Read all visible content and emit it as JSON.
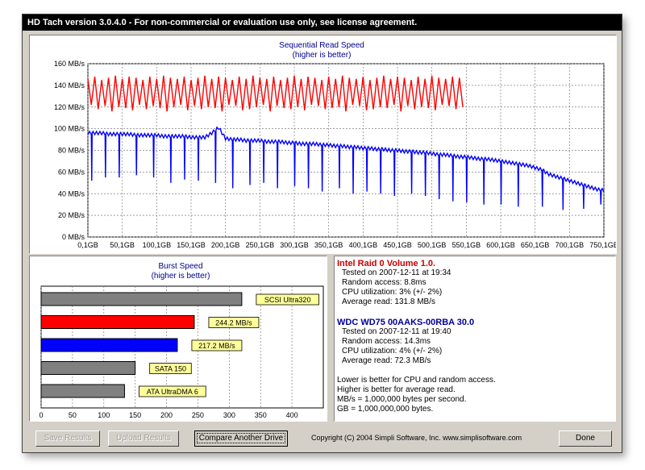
{
  "window": {
    "title": "HD Tach version 3.0.4.0  - For non-commercial or evaluation use only, see license agreement."
  },
  "colors": {
    "drive1": "#ff0000",
    "drive2": "#0000ff",
    "grey_bar": "#808080",
    "label_bg": "#ffff99",
    "title_text": "#00008b"
  },
  "chart_data": [
    {
      "type": "line",
      "title": "Sequential Read Speed",
      "subtitle": "(higher is better)",
      "ylim": [
        0,
        160
      ],
      "yticks": [
        "0 MB/s",
        "20 MB/s",
        "40 MB/s",
        "60 MB/s",
        "80 MB/s",
        "100 MB/s",
        "120 MB/s",
        "140 MB/s",
        "160 MB/s"
      ],
      "xlim": [
        0.1,
        750.1
      ],
      "xticks": [
        "0,1GB",
        "50,1GB",
        "100,1GB",
        "150,1GB",
        "200,1GB",
        "250,1GB",
        "300,1GB",
        "350,1GB",
        "400,1GB",
        "450,1GB",
        "500,1GB",
        "550,1GB",
        "600,1GB",
        "650,1GB",
        "700,1GB",
        "750,1GB"
      ],
      "grid": true,
      "series": [
        {
          "name": "Intel Raid 0 Volume 1.0.",
          "color": "#ff0000",
          "x": [
            0,
            10,
            20,
            30,
            40,
            50,
            60,
            70,
            80,
            90,
            100,
            110,
            120,
            130,
            140,
            150,
            160,
            170,
            180,
            190,
            200,
            210,
            220,
            230,
            240,
            250,
            260,
            270,
            280,
            290,
            300,
            310,
            320,
            330,
            340,
            350,
            360,
            370,
            380,
            390,
            400,
            410,
            420,
            430,
            440,
            450,
            460,
            470,
            480,
            490,
            500,
            510,
            520,
            530,
            540
          ],
          "high": [
            146,
            148,
            145,
            147,
            149,
            146,
            148,
            147,
            145,
            148,
            146,
            149,
            147,
            146,
            148,
            145,
            147,
            149,
            146,
            148,
            147,
            145,
            148,
            146,
            149,
            147,
            146,
            148,
            145,
            147,
            149,
            146,
            148,
            147,
            145,
            148,
            146,
            149,
            147,
            146,
            148,
            145,
            147,
            149,
            146,
            148,
            147,
            145,
            148,
            146,
            149,
            147,
            146,
            148,
            147
          ],
          "low": [
            122,
            118,
            121,
            116,
            120,
            119,
            117,
            122,
            118,
            121,
            119,
            116,
            120,
            122,
            117,
            121,
            118,
            120,
            119,
            116,
            122,
            121,
            117,
            118,
            120,
            122,
            116,
            121,
            119,
            118,
            120,
            117,
            122,
            121,
            118,
            119,
            120,
            116,
            122,
            121,
            117,
            118,
            120,
            119,
            122,
            116,
            121,
            118,
            120,
            119,
            117,
            122,
            121,
            118,
            120
          ]
        },
        {
          "name": "WDC WD75 00AAKS-00RBA 30.0",
          "color": "#0000ff",
          "x": [
            0,
            10,
            20,
            30,
            40,
            50,
            60,
            70,
            80,
            90,
            100,
            110,
            120,
            130,
            140,
            150,
            160,
            170,
            180,
            190,
            200,
            210,
            220,
            230,
            240,
            250,
            260,
            270,
            280,
            290,
            300,
            310,
            320,
            330,
            340,
            350,
            360,
            370,
            380,
            390,
            400,
            410,
            420,
            430,
            440,
            450,
            460,
            470,
            480,
            490,
            500,
            510,
            520,
            530,
            540,
            550,
            560,
            570,
            580,
            590,
            600,
            610,
            620,
            630,
            640,
            650,
            660,
            670,
            680,
            690,
            700,
            710,
            720,
            730,
            740,
            750
          ],
          "values": [
            96,
            96,
            96,
            95,
            95,
            95,
            95,
            94,
            94,
            94,
            94,
            93,
            93,
            93,
            93,
            92,
            92,
            92,
            96,
            101,
            91,
            90,
            90,
            89,
            89,
            89,
            88,
            88,
            88,
            87,
            87,
            86,
            86,
            86,
            85,
            85,
            84,
            84,
            83,
            83,
            82,
            82,
            81,
            81,
            80,
            80,
            79,
            79,
            78,
            78,
            77,
            76,
            76,
            75,
            74,
            74,
            73,
            72,
            72,
            71,
            70,
            69,
            68,
            67,
            66,
            64,
            62,
            58,
            56,
            54,
            52,
            50,
            48,
            46,
            44,
            43
          ],
          "dips": [
            [
              5,
              52
            ],
            [
              25,
              55
            ],
            [
              45,
              55
            ],
            [
              70,
              57
            ],
            [
              95,
              55
            ],
            [
              120,
              50
            ],
            [
              140,
              53
            ],
            [
              160,
              52
            ],
            [
              185,
              50
            ],
            [
              210,
              45
            ],
            [
              235,
              48
            ],
            [
              255,
              50
            ],
            [
              275,
              45
            ],
            [
              300,
              47
            ],
            [
              320,
              45
            ],
            [
              340,
              42
            ],
            [
              365,
              45
            ],
            [
              385,
              40
            ],
            [
              405,
              42
            ],
            [
              425,
              40
            ],
            [
              445,
              38
            ],
            [
              470,
              40
            ],
            [
              490,
              38
            ],
            [
              510,
              35
            ],
            [
              530,
              33
            ],
            [
              550,
              32
            ],
            [
              575,
              30
            ],
            [
              600,
              30
            ],
            [
              625,
              28
            ],
            [
              660,
              28
            ],
            [
              690,
              25
            ],
            [
              720,
              26
            ],
            [
              745,
              30
            ]
          ]
        }
      ]
    },
    {
      "type": "bar",
      "orientation": "horizontal",
      "title": "Burst Speed",
      "subtitle": "(higher is better)",
      "xlim": [
        0,
        450
      ],
      "xticks": [
        "0",
        "50",
        "100",
        "150",
        "200",
        "250",
        "300",
        "350",
        "400"
      ],
      "grid": true,
      "bars": [
        {
          "value": 320,
          "color": "#808080",
          "label": "SCSI Ultra320"
        },
        {
          "value": 244.2,
          "color": "#ff0000",
          "label": "244.2 MB/s"
        },
        {
          "value": 217.2,
          "color": "#0000ff",
          "label": "217.2 MB/s"
        },
        {
          "value": 150,
          "color": "#808080",
          "label": "SATA 150"
        },
        {
          "value": 133,
          "color": "#808080",
          "label": "ATA UltraDMA 6"
        }
      ]
    }
  ],
  "info": {
    "drive1": {
      "name": "Intel Raid 0 Volume 1.0.",
      "color": "#cc0000",
      "tested": "Tested on 2007-12-11 at 19:34",
      "random_access": "Random access: 8.8ms",
      "cpu": "CPU utilization: 3% (+/- 2%)",
      "avg_read": "Average read: 131.8 MB/s"
    },
    "drive2": {
      "name": "WDC WD75 00AAKS-00RBA 30.0",
      "color": "#000099",
      "tested": "Tested on 2007-12-11 at 19:40",
      "random_access": "Random access: 14.3ms",
      "cpu": "CPU utilization: 4% (+/- 2%)",
      "avg_read": "Average read: 72.3 MB/s"
    },
    "notes": [
      "Lower is better for CPU and random access.",
      "Higher is better for average read.",
      "MB/s = 1,000,000 bytes per second.",
      "GB = 1,000,000,000 bytes."
    ]
  },
  "buttons": {
    "save": "Save Results",
    "upload": "Upload Results",
    "compare": "Compare Another Drive",
    "done": "Done"
  },
  "copyright": "Copyright (C) 2004 Simpli Software, Inc. www.simplisoftware.com"
}
